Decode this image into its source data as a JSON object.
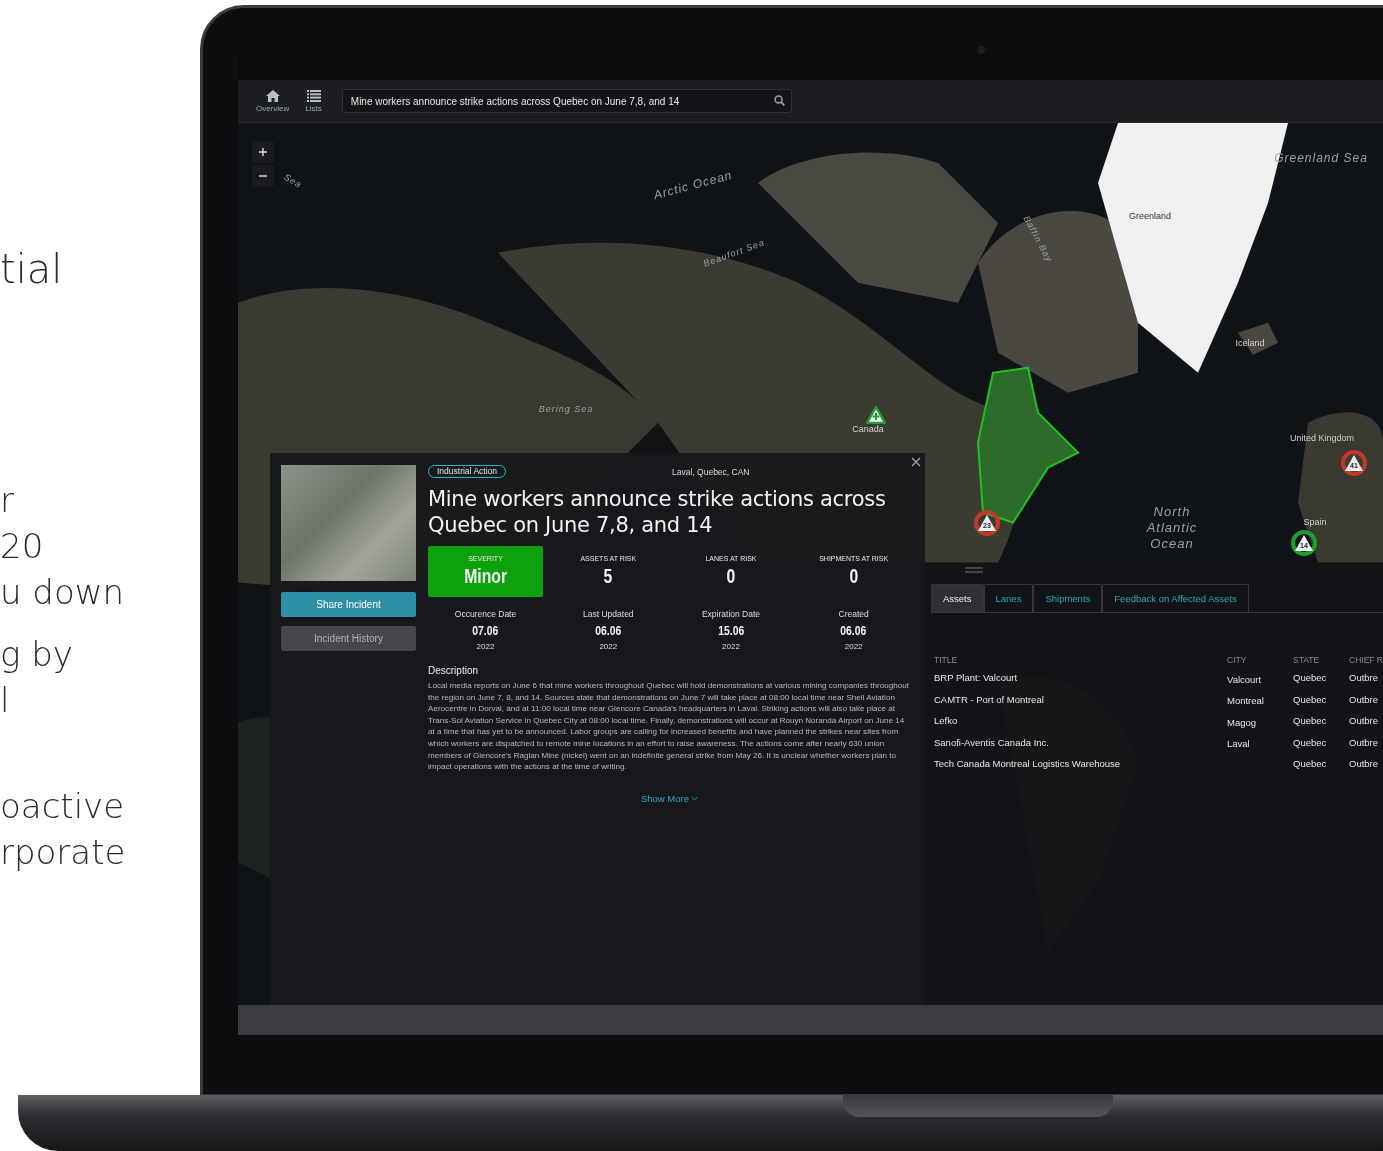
{
  "marketing_text": [
    {
      "lines": [
        "tial"
      ]
    },
    {
      "lines": [
        "r",
        "20",
        "u down"
      ]
    },
    {
      "lines": [
        "g by",
        "l"
      ]
    },
    {
      "lines": [
        "oactive",
        "rporate"
      ]
    }
  ],
  "toolbar": {
    "nav": [
      {
        "label": "Overview",
        "kind": "home"
      },
      {
        "label": "Lists",
        "kind": "list"
      }
    ],
    "search": {
      "value": "Mine workers announce strike actions across Quebec on June 7,8, and 14"
    }
  },
  "map": {
    "labels": [
      {
        "text": "Sea"
      },
      {
        "text": "Arctic Ocean"
      },
      {
        "text": "Beaufort Sea"
      },
      {
        "text": "Baffin Bay"
      },
      {
        "text": "Greenland"
      },
      {
        "text": "Greenland Sea"
      },
      {
        "text": "Iceland"
      },
      {
        "text": "Bering Sea"
      },
      {
        "text": "North Atlantic Ocean"
      },
      {
        "text": "United Kingdom"
      },
      {
        "text": "Spain"
      },
      {
        "text": "Canada"
      }
    ],
    "markers": [
      {
        "label": "23",
        "color": "#c0392b"
      },
      {
        "label": "41",
        "color": "#c0392b"
      },
      {
        "label": "14",
        "color": "#1e9e2e"
      }
    ]
  },
  "incident": {
    "category": "Industrial Action",
    "location": "Laval, Quebec, CAN",
    "title": "Mine workers announce strike actions across Quebec on June 7,8, and 14",
    "severity": {
      "label": "SEVERITY",
      "value": "Minor"
    },
    "stats": [
      {
        "label": "ASSETS AT RISK",
        "value": "5"
      },
      {
        "label": "LANES AT RISK",
        "value": "0"
      },
      {
        "label": "SHIPMENTS AT RISK",
        "value": "0"
      }
    ],
    "dates": [
      {
        "label": "Occurence Date",
        "value": "07.06",
        "year": "2022"
      },
      {
        "label": "Last Updated",
        "value": "06.06",
        "year": "2022"
      },
      {
        "label": "Expiration Date",
        "value": "15.06",
        "year": "2022"
      },
      {
        "label": "Created",
        "value": "06.06",
        "year": "2022"
      }
    ],
    "buttons": [
      "Share Incident",
      "Incident History"
    ],
    "description_heading": "Description",
    "description": "Local media reports on June 6 that mine workers throughout Quebec will hold demonstrations at various mining companies throughout the region on June 7, 8, and 14. Sources state that demonstrations on June 7 will take place at 08:00 local time near Shell Aviation Aerocentre in Dorval, and at 11:00 local time near Glencore Canada's headquarters in Laval. Striking actions will also take place at Trans-Sol Aviation Service in Quebec City at 08:00 local time. Finally, demonstrations will occur at Rouyn Noranda Airport on June 14 at a time that has yet to be announced. Labor groups are calling for increased benefits and have planned the strikes near sites from which workers are dispatched to remote mine locations in an effort to raise awareness. The actions come after nearly 630 union members of Glencore's Raglan Mine (nickel) went on an indefinite general strike from May 26. It is unclear whether workers plan to impact operations with the actions at the time of writing.",
    "show_more": "Show More"
  },
  "assets_panel": {
    "tabs": [
      {
        "label": "Assets",
        "selected": true
      },
      {
        "label": "Lanes",
        "selected": false
      },
      {
        "label": "Shipments",
        "selected": false
      },
      {
        "label": "Feedback on Affected Assets",
        "selected": false
      }
    ],
    "columns": [
      "TITLE",
      "CITY",
      "STATE",
      "CHIEF R"
    ],
    "rows": [
      {
        "title": "BRP Plant: Valcourt",
        "city": "Valcourt",
        "state": "Quebec",
        "column_4": "Outbre"
      },
      {
        "title": "CAMTR - Port of Montreal",
        "city": "Montreal",
        "state": "Quebec",
        "column_4": "Outbre"
      },
      {
        "title": "Lefko",
        "city": "Magog",
        "state": "Quebec",
        "column_4": "Outbre"
      },
      {
        "title": "Sanofi-Aventis Canada Inc.",
        "city": "Laval",
        "state": "Quebec",
        "column_4": "Outbre"
      },
      {
        "title": "Tech Canada Montreal Logistics Warehouse",
        "state": "Quebec",
        "column_4": "Outbre"
      }
    ]
  }
}
